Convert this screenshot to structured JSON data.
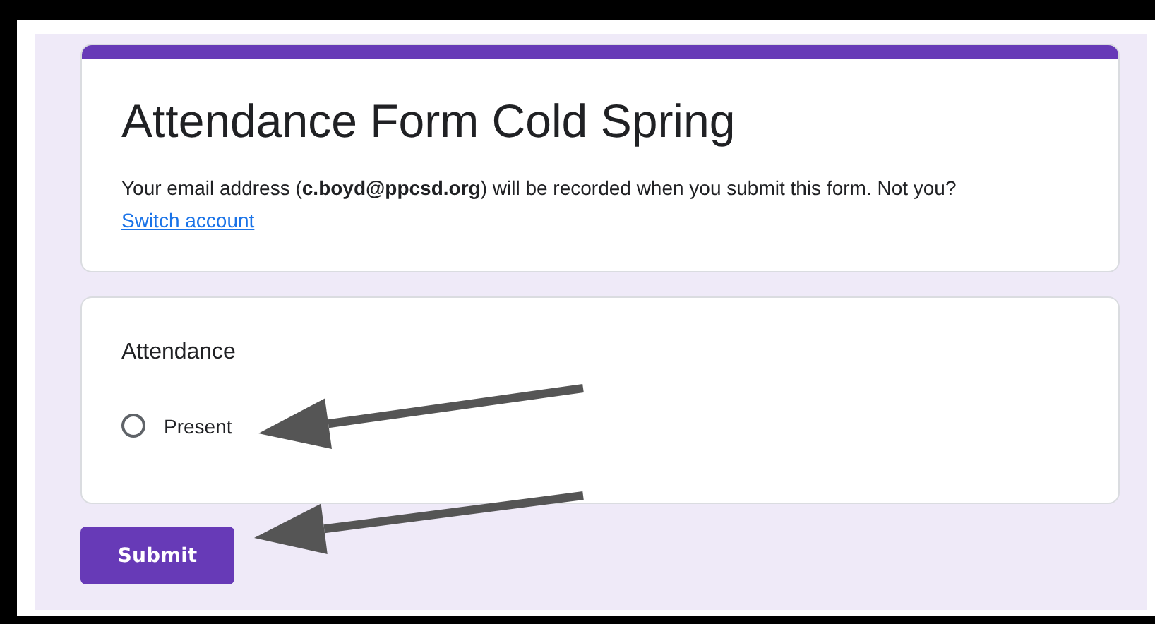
{
  "form": {
    "title": "Attendance Form Cold Spring",
    "description": "Your email address (**c.boyd@ppcsd.org**) will be recorded when you submit this form. Not you?",
    "link": "Switch account"
  },
  "question": {
    "label": "Attendance",
    "options": [
      {
        "label": "Present",
        "selected": false
      }
    ]
  },
  "submit_button": "Submit"
}
